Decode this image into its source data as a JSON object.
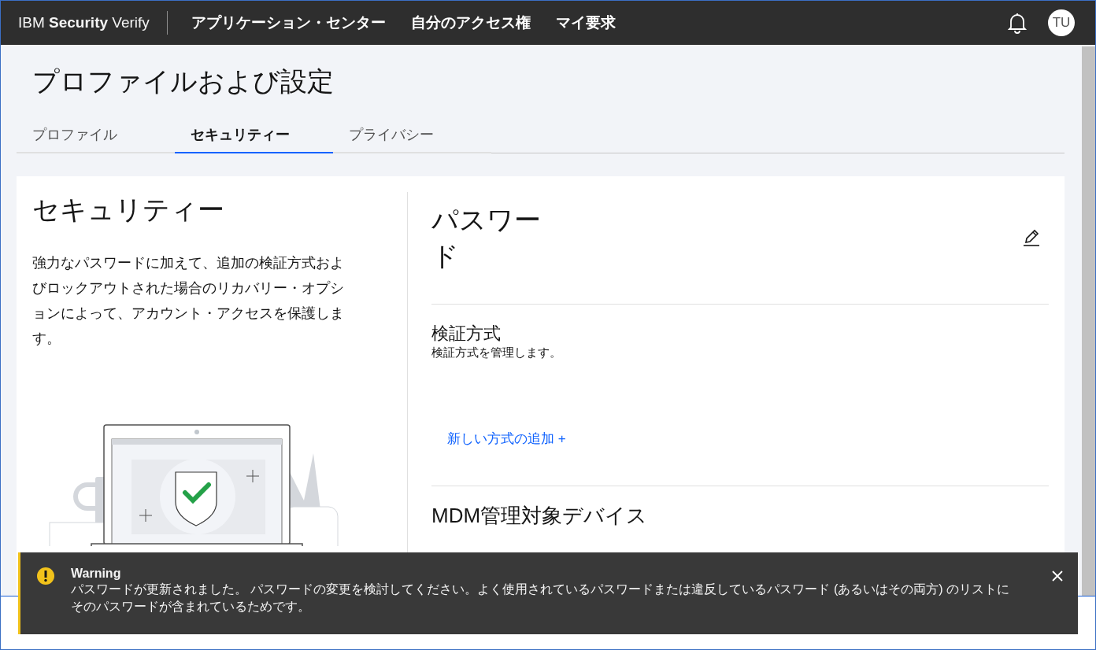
{
  "header": {
    "brand": {
      "prefix": "IBM",
      "bold": "Security",
      "suffix": "Verify"
    },
    "nav": [
      "アプリケーション・センター",
      "自分のアクセス権",
      "マイ要求"
    ],
    "avatar": "TU"
  },
  "page": {
    "title": "プロファイルおよび設定"
  },
  "tabs": [
    {
      "label": "プロファイル",
      "selected": false
    },
    {
      "label": "セキュリティー",
      "selected": true
    },
    {
      "label": "プライバシー",
      "selected": false
    }
  ],
  "security": {
    "title": "セキュリティー",
    "description": "強力なパスワードに加えて、追加の検証方式およびロックアウトされた場合のリカバリー・オプションによって、アカウント・アクセスを保護します。"
  },
  "sections": [
    {
      "kind": "editable",
      "title": "パスワード"
    },
    {
      "kind": "methods",
      "title": "検証方式",
      "subtitle": "検証方式を管理します。",
      "link": "新しい方式の追加 +"
    },
    {
      "kind": "plain",
      "title": "MDM管理対象デバイス"
    }
  ],
  "notification": {
    "kind": "warning",
    "title": "Warning",
    "message": "パスワードが更新されました。 パスワードの変更を検討してください。よく使用されているパスワードまたは違反しているパスワード (あるいはその両方) のリストにそのパスワードが含まれているためです。"
  }
}
